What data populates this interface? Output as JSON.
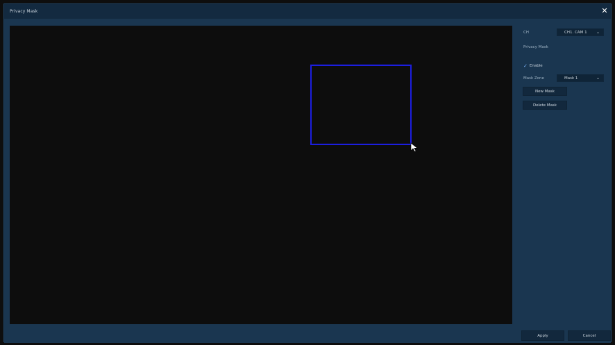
{
  "window": {
    "title": "Privacy Mask",
    "close_icon": "close-icon"
  },
  "panel": {
    "channel_label": "CH",
    "channel_value": "CH1. CAM 1",
    "privacy_mask_label": "Privacy Mask",
    "enable_label": "Enable",
    "enable_checked": true,
    "mask_zone_label": "Mask Zone",
    "mask_zone_value": "Mask 1",
    "new_mask_label": "New Mask",
    "delete_mask_label": "Delete Mask"
  },
  "footer": {
    "apply_label": "Apply",
    "cancel_label": "Cancel"
  },
  "colors": {
    "mask_border": "#1c1ee0",
    "background": "#1a3650",
    "video": "#0d0d0d"
  }
}
